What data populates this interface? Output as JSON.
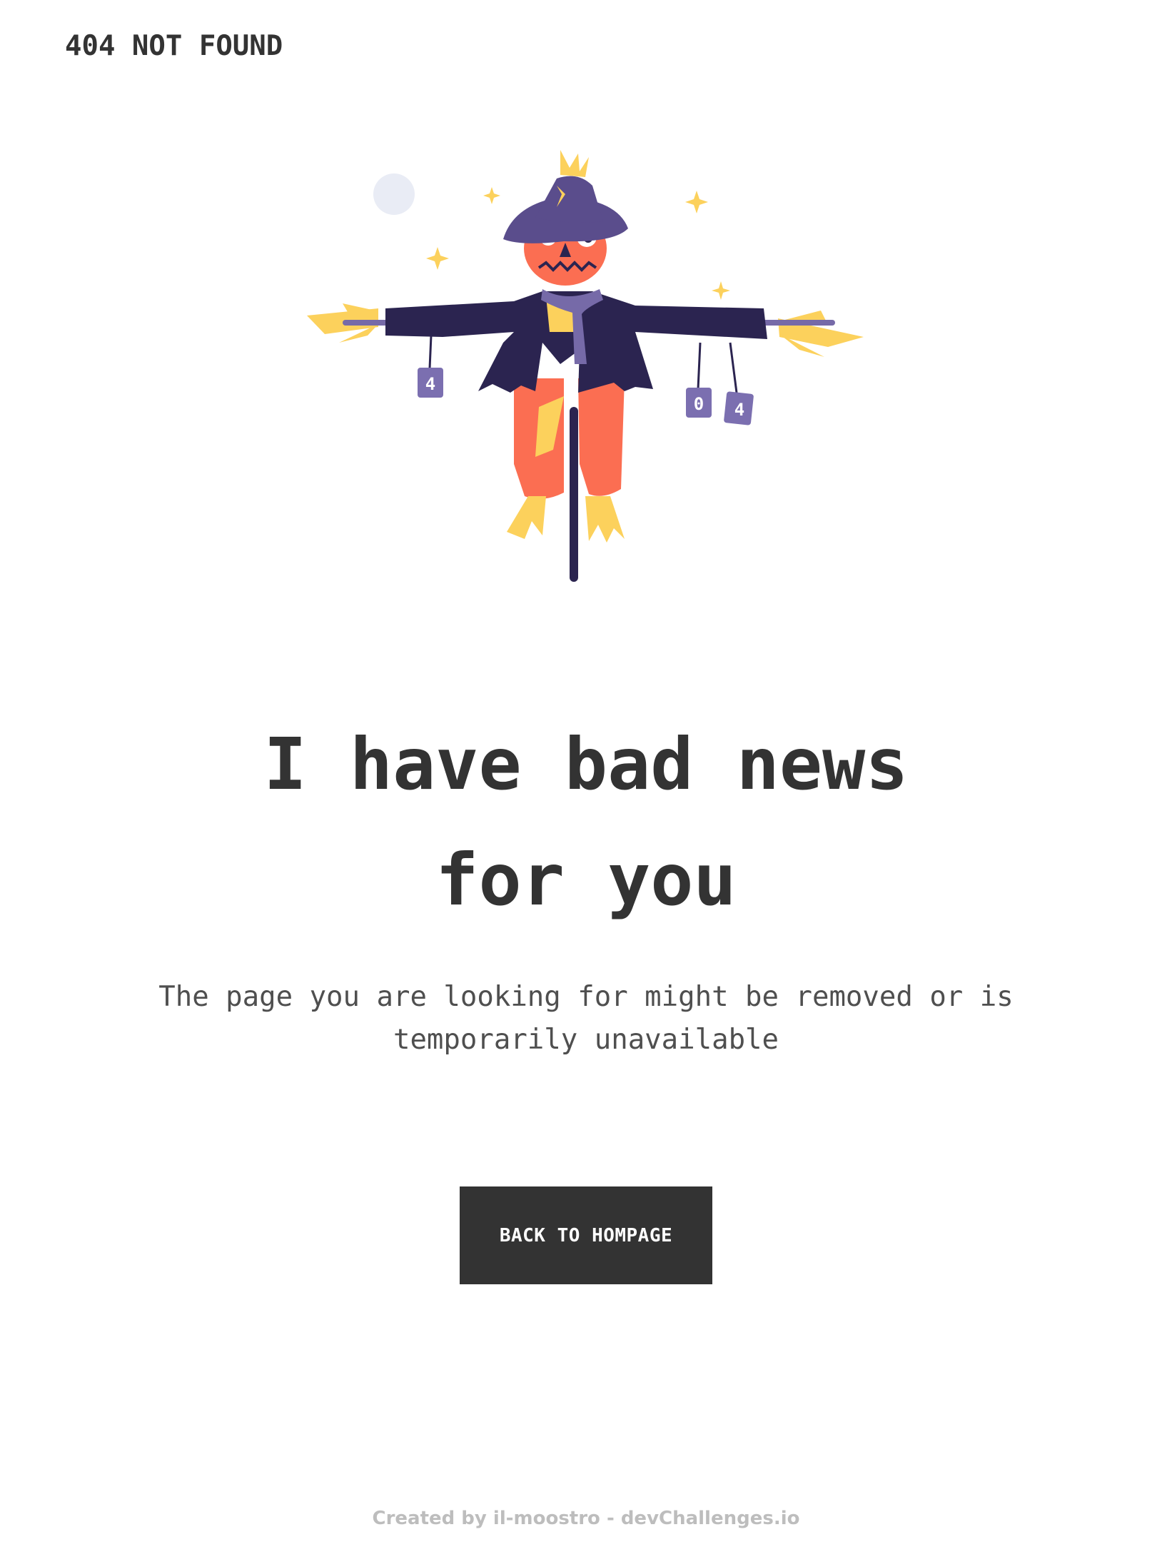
{
  "header": {
    "brand_label": "404 NOT FOUND"
  },
  "illustration": {
    "name": "scarecrow-illustration",
    "can_labels": [
      "4",
      "0",
      "4"
    ],
    "colors": {
      "hat": "#5a4d8c",
      "coat": "#2b2450",
      "face": "#fb6e52",
      "straw": "#fcd15c",
      "scarf": "#766aa8",
      "moon": "#e9ecf5",
      "can": "#7b6fb0"
    }
  },
  "main": {
    "headline_line1": "I have bad news",
    "headline_line2": "for you",
    "message_line1": "The page you are looking for might be removed or is",
    "message_line2": "temporarily unavailable",
    "button_label": "BACK TO HOMPAGE"
  },
  "footer": {
    "credit": "Created by il-moostro - devChallenges.io"
  },
  "theme": {
    "text": "#333333",
    "button_bg": "#333333",
    "button_text": "#ffffff",
    "footer_text": "#bdbdbd"
  }
}
